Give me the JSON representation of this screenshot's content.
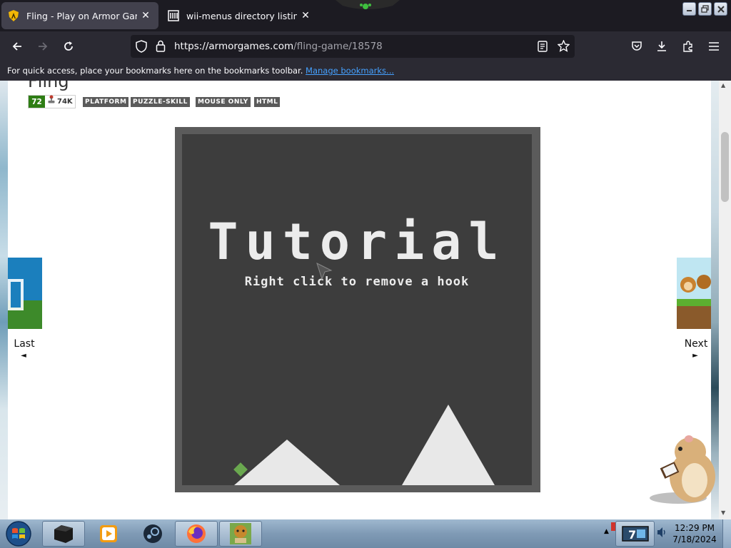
{
  "browser": {
    "tabs": [
      {
        "title": "Fling - Play on Armor Games",
        "active": true,
        "icon": "armor-games-shield-icon"
      },
      {
        "title": "wii-menus directory listing",
        "active": false,
        "icon": "library-icon"
      }
    ],
    "url": {
      "host": "https://armorgames.com",
      "path": "/fling-game/18578"
    },
    "bookmarks_bar": {
      "text": "For quick access, place your bookmarks here on the bookmarks toolbar.",
      "link": "Manage bookmarks..."
    }
  },
  "page": {
    "game_title": "Fling",
    "rating": "72",
    "plays": "74K",
    "tags": [
      "PLATFORM",
      "PUZZLE-SKILL",
      "MOUSE ONLY",
      "HTML"
    ],
    "game": {
      "title": "Tutorial",
      "instruction": "Right click to remove a hook"
    },
    "nav_prev": {
      "label": "Last",
      "arrow": "◄"
    },
    "nav_next": {
      "label": "Next",
      "arrow": "►"
    }
  },
  "taskbar": {
    "time": "12:29 PM",
    "date": "7/18/2024"
  },
  "colors": {
    "game_frame": "#5b5b5b",
    "game_bg": "#3d3d3d",
    "rating_green": "#2e7d14",
    "link_blue": "#45a1ff"
  }
}
